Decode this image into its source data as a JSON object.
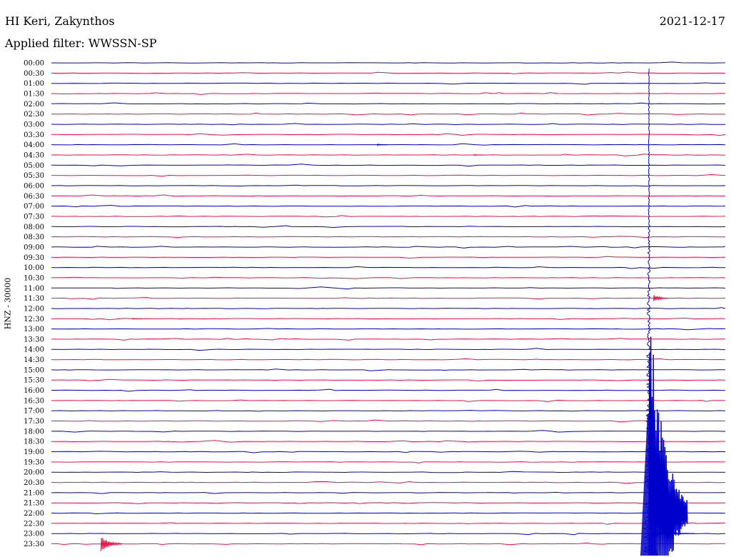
{
  "header": {
    "station": "HI Keri, Zakynthos",
    "date": "2021-12-17",
    "filter": "Applied filter: WWSSN-SP"
  },
  "colors": {
    "trace_a": "#0000cc",
    "trace_b": "#ee1144",
    "background": "#ffffff",
    "text": "#000000"
  },
  "chart_data": {
    "type": "line",
    "title": "",
    "xlabel": "",
    "ylabel": "HNZ - 30000",
    "grid": false,
    "legend": "none",
    "x_range_minutes": [
      0,
      30
    ],
    "row_labels": [
      "00:00",
      "00:30",
      "01:00",
      "01:30",
      "02:00",
      "02:30",
      "03:00",
      "03:30",
      "04:00",
      "04:30",
      "05:00",
      "05:30",
      "06:00",
      "06:30",
      "07:00",
      "07:30",
      "08:00",
      "08:30",
      "09:00",
      "09:30",
      "10:00",
      "10:30",
      "11:00",
      "11:30",
      "12:00",
      "12:30",
      "13:00",
      "13:30",
      "14:00",
      "14:30",
      "15:00",
      "15:30",
      "16:00",
      "16:30",
      "17:00",
      "17:30",
      "18:00",
      "18:30",
      "19:00",
      "19:30",
      "20:00",
      "20:30",
      "21:00",
      "21:30",
      "22:00",
      "22:30",
      "23:00",
      "23:30"
    ],
    "row_colors": [
      "trace_a",
      "trace_b"
    ],
    "events": [
      {
        "row": "04:00",
        "minute": 14.5,
        "amplitude": 0.2
      },
      {
        "row": "04:30",
        "minute": 18.8,
        "amplitude": 0.15
      },
      {
        "row": "11:30",
        "minute": 26.8,
        "amplitude": 0.8
      },
      {
        "row": "12:30",
        "minute": 3.6,
        "amplitude": 0.12
      },
      {
        "row": "23:30",
        "minute": 2.2,
        "amplitude": 1.6
      },
      {
        "row": "22:00",
        "minute": 26.6,
        "amplitude": 45
      }
    ]
  }
}
